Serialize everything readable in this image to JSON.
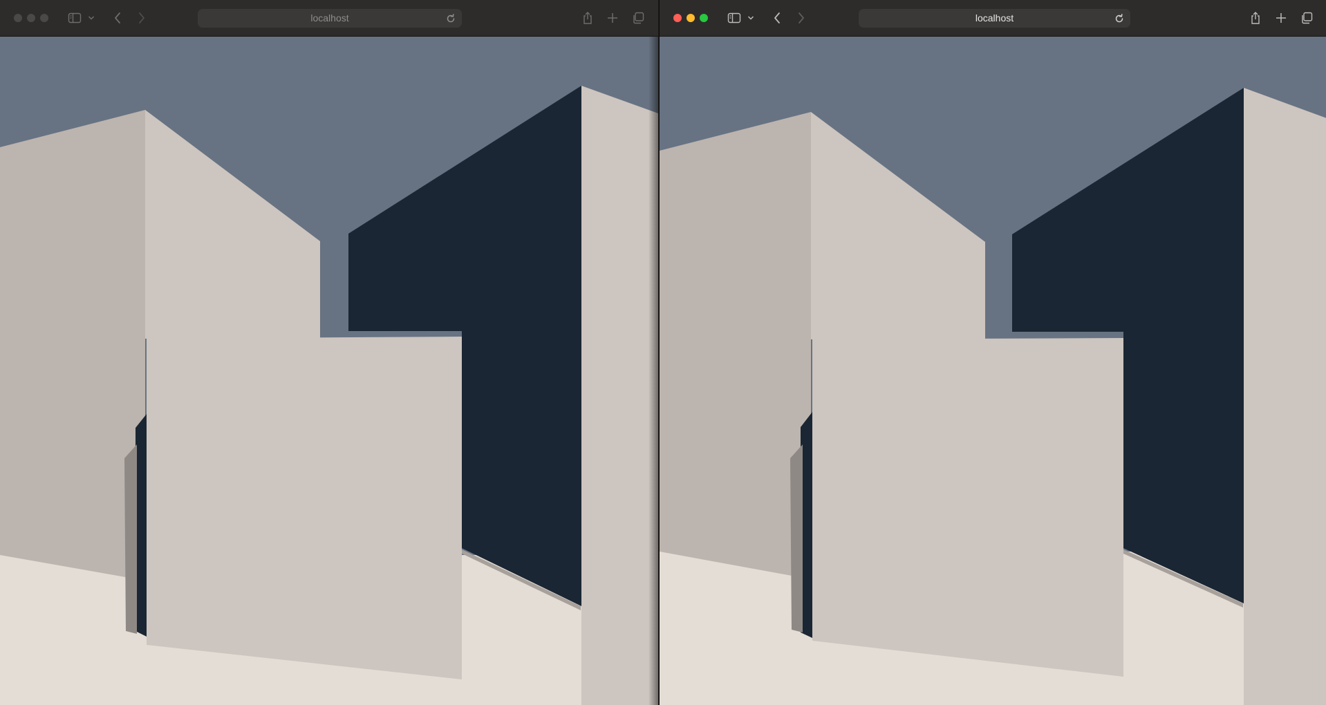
{
  "windows": [
    {
      "id": "left",
      "focused": false,
      "url": "localhost"
    },
    {
      "id": "right",
      "focused": true,
      "url": "localhost"
    }
  ],
  "colors": {
    "sky": "#677383",
    "dark_wall": "#1a2633",
    "wall_light": "#cdc5bf",
    "wall_shadow": "#bcb4ae",
    "floor": "#e4ddd5",
    "traffic_close": "#ff5f57",
    "traffic_min": "#febc2e",
    "traffic_max": "#28c840",
    "traffic_inactive": "#4a4948"
  }
}
